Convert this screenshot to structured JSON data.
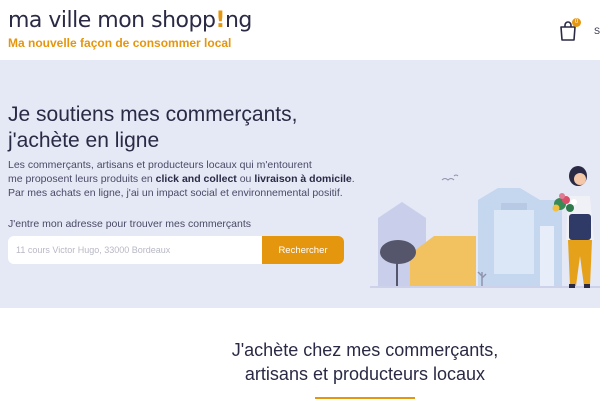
{
  "header": {
    "logo_pre": "ma ville mon shopp",
    "logo_i": "!",
    "logo_post": "ng",
    "tagline": "Ma nouvelle façon de consommer local",
    "cart_count": "0",
    "cut_text": "S"
  },
  "hero": {
    "title_line1": "Je soutiens mes commerçants,",
    "title_line2": "j'achète en ligne",
    "text_1": "Les commerçants, artisans et producteurs locaux qui m'entourent",
    "text_2a": "me proposent leurs produits en ",
    "text_2b": "click and collect",
    "text_2c": " ou ",
    "text_2d": "livraison à domicile",
    "text_2e": ".",
    "text_3": "Par mes achats en ligne, j'ai un impact social et environnemental positif.",
    "address_label": "J'entre mon adresse pour trouver mes commerçants",
    "address_placeholder": "11 cours Victor Hugo, 33000 Bordeaux",
    "search_label": "Rechercher"
  },
  "section": {
    "title_line1": "J'achète chez mes commerçants,",
    "title_line2": "artisans et producteurs locaux"
  },
  "colors": {
    "accent": "#e5960f",
    "text": "#2a2a45",
    "hero_bg": "#e5e8f5"
  }
}
